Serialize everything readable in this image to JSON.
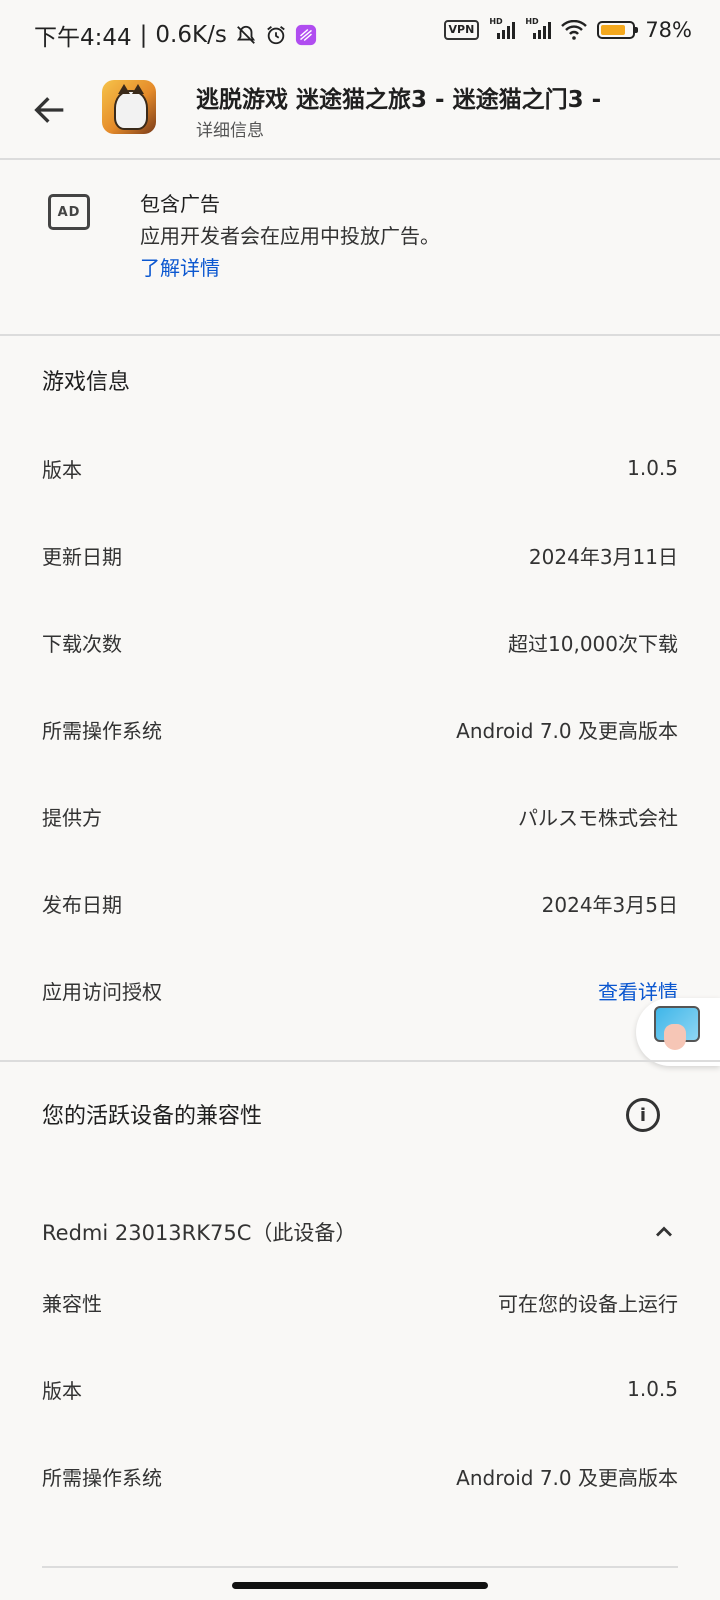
{
  "status_bar": {
    "time": "下午4:44",
    "speed": "0.6K/s",
    "vpn_label": "VPN",
    "hd_label": "HD",
    "battery_percent": "78%",
    "battery_level": 0.78,
    "battery_color": "#f4a81d"
  },
  "app_bar": {
    "title": "逃脱游戏 迷途猫之旅3 - 迷途猫之门3 -",
    "subtitle": "详细信息"
  },
  "ads": {
    "icon_label": "AD",
    "title": "包含广告",
    "description": "应用开发者会在应用中投放广告。",
    "learn_more": "了解详情"
  },
  "game_info": {
    "title": "游戏信息",
    "rows": [
      {
        "label": "版本",
        "value": "1.0.5"
      },
      {
        "label": "更新日期",
        "value": "2024年3月11日"
      },
      {
        "label": "下载次数",
        "value": "超过10,000次下载"
      },
      {
        "label": "所需操作系统",
        "value": "Android 7.0 及更高版本"
      },
      {
        "label": "提供方",
        "value": "パルスモ株式会社"
      },
      {
        "label": "发布日期",
        "value": "2024年3月5日"
      },
      {
        "label": "应用访问授权",
        "value": "查看详情"
      }
    ]
  },
  "compatibility": {
    "title": "您的活跃设备的兼容性",
    "info_icon_label": "i",
    "device_name": "Redmi 23013RK75C（此设备）",
    "rows": [
      {
        "label": "兼容性",
        "value": "可在您的设备上运行"
      },
      {
        "label": "版本",
        "value": "1.0.5"
      },
      {
        "label": "所需操作系统",
        "value": "Android 7.0 及更高版本"
      }
    ]
  },
  "colors": {
    "link": "#0b57d0",
    "background": "#f9f8f6",
    "divider": "#dcdcdc"
  }
}
